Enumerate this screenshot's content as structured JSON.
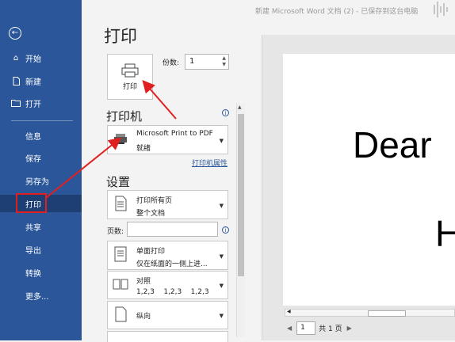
{
  "window": {
    "title": "新建 Microsoft Word 文档 (2) - 已保存到这台电脑"
  },
  "sidebar": {
    "back_icon": "back-arrow-icon",
    "items": [
      {
        "label": "开始",
        "icon": "home-icon"
      },
      {
        "label": "新建",
        "icon": "new-doc-icon"
      },
      {
        "label": "打开",
        "icon": "folder-icon"
      },
      {
        "label": "信息"
      },
      {
        "label": "保存"
      },
      {
        "label": "另存为"
      },
      {
        "label": "打印",
        "active": true
      },
      {
        "label": "共享"
      },
      {
        "label": "导出"
      },
      {
        "label": "转换"
      },
      {
        "label": "更多..."
      }
    ]
  },
  "print": {
    "page_title": "打印",
    "print_button_label": "打印",
    "copies_label": "份数:",
    "copies_value": "1",
    "printer_section": "打印机",
    "printer_name": "Microsoft Print to PDF",
    "printer_status": "就绪",
    "printer_properties_link": "打印机属性",
    "settings_section": "设置",
    "range": {
      "main": "打印所有页",
      "sub": "整个文档"
    },
    "pages_label": "页数:",
    "pages_value": "",
    "sides": {
      "main": "单面打印",
      "sub": "仅在纸面的一侧上进..."
    },
    "collate": {
      "main": "对照",
      "sub": "1,2,3    1,2,3    1,2,3"
    },
    "orientation": {
      "main": "纵向"
    }
  },
  "preview": {
    "text_line1": "Dear",
    "text_line2": "H",
    "page_input": "1",
    "page_total": "共 1 页"
  },
  "colors": {
    "sidebar": "#2b579a",
    "accent_red": "#e02020"
  }
}
